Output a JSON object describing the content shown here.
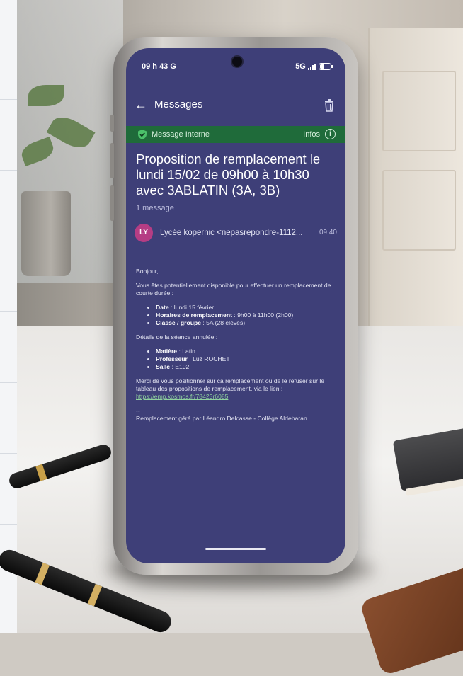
{
  "status_bar": {
    "time": "09 h 43",
    "google": "G",
    "network": "5G"
  },
  "app_bar": {
    "title": "Messages",
    "back_icon": "arrow-left-icon",
    "trash_icon": "trash-icon"
  },
  "banner": {
    "label": "Message Interne",
    "infos": "Infos",
    "info_glyph": "i",
    "color": "#1f6b3a"
  },
  "message": {
    "subject": "Proposition de remplacement le lundi 15/02 de 09h00 à 10h30 avec 3ABLATIN (3A, 3B)",
    "count": "1 message",
    "avatar_initials": "LY",
    "sender": "Lycée kopernic <nepasrepondre-1112...",
    "time": "09:40",
    "greeting": "Bonjour,",
    "intro": "Vous êtes potentiellement disponible pour effectuer un remplacement de courte durée :",
    "details": [
      {
        "label": "Date",
        "value": " : lundi 15 février"
      },
      {
        "label": "Horaires de remplacement",
        "value": " : 9h00 à 11h00 (2h00)"
      },
      {
        "label": "Classe / groupe",
        "value": " : 5A (28 élèves)"
      }
    ],
    "session_heading": "Détails de la séance annulée :",
    "session": [
      {
        "label": "Matière",
        "value": " : Latin"
      },
      {
        "label": "Professeur",
        "value": " : Luz ROCHET"
      },
      {
        "label": "Salle",
        "value": " : E102"
      }
    ],
    "closing": "Merci de vous positionner sur ca remplacement ou de le refuser sur le tableau des propositions de remplacement, via le lien :",
    "link": "https://emp.kosmos.fr/78423r6085",
    "separator": "--",
    "signature": "Remplacement géré par Léandro Delcasse - Collège Aldebaran"
  },
  "colors": {
    "screen_bg": "#3e3f78",
    "avatar_bg": "#b53d84",
    "link": "#8fd19e"
  }
}
